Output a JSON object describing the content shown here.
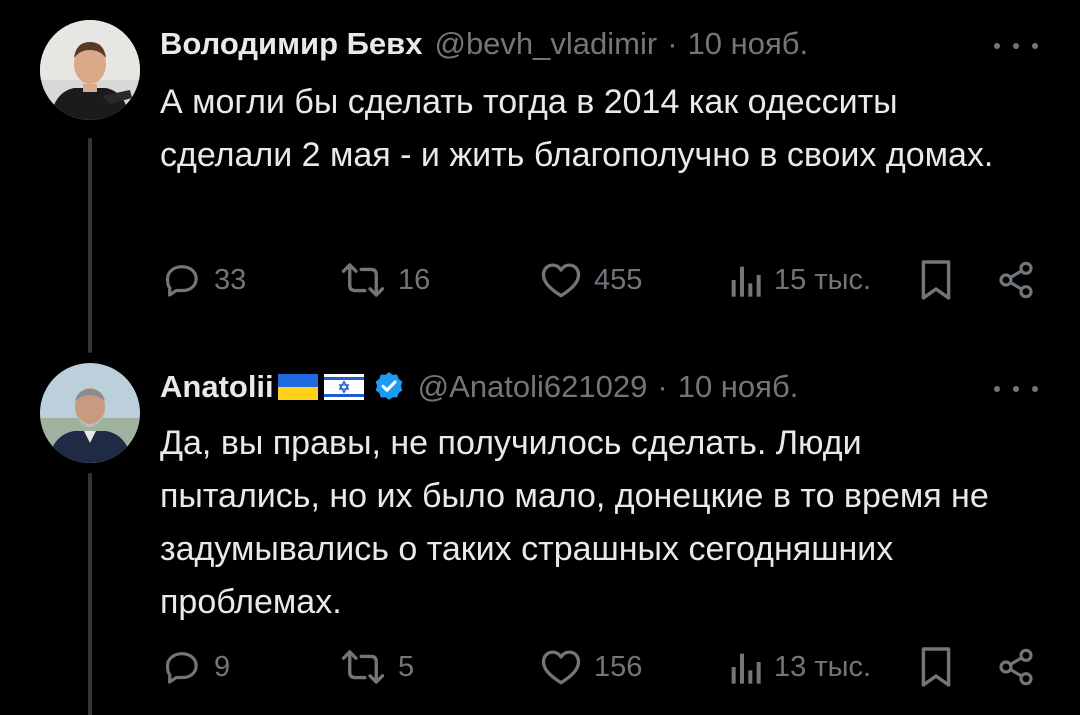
{
  "tweets": [
    {
      "author_name": "Володимир Бевх",
      "handle": "@bevh_vladimir",
      "separator": "·",
      "date": "10 нояб.",
      "text": "А могли бы сделать тогда в 2014 как одесситы сделали 2 мая - и жить благополучно в своих домах.",
      "replies": "33",
      "reposts": "16",
      "likes": "455",
      "views": "15 тыс.",
      "more_icon": "more-horizontal-icon",
      "verified": false
    },
    {
      "author_name": "Anatolii",
      "flags": [
        "ukraine-flag",
        "israel-flag"
      ],
      "handle": "@Anatoli621029",
      "separator": "·",
      "date": "10 нояб.",
      "text": "Да, вы правы, не получилось сделать. Люди пытались, но их было мало, донецкие в то время не задумывались о таких страшных сегодняшних проблемах.",
      "replies": "9",
      "reposts": "5",
      "likes": "156",
      "views": "13 тыс.",
      "more_icon": "more-horizontal-icon",
      "verified": true
    }
  ],
  "colors": {
    "background": "#000000",
    "primary_text": "#e7e9ea",
    "secondary_text": "#71767b",
    "verified_blue": "#1d9bf0",
    "thread_line": "#333639"
  }
}
